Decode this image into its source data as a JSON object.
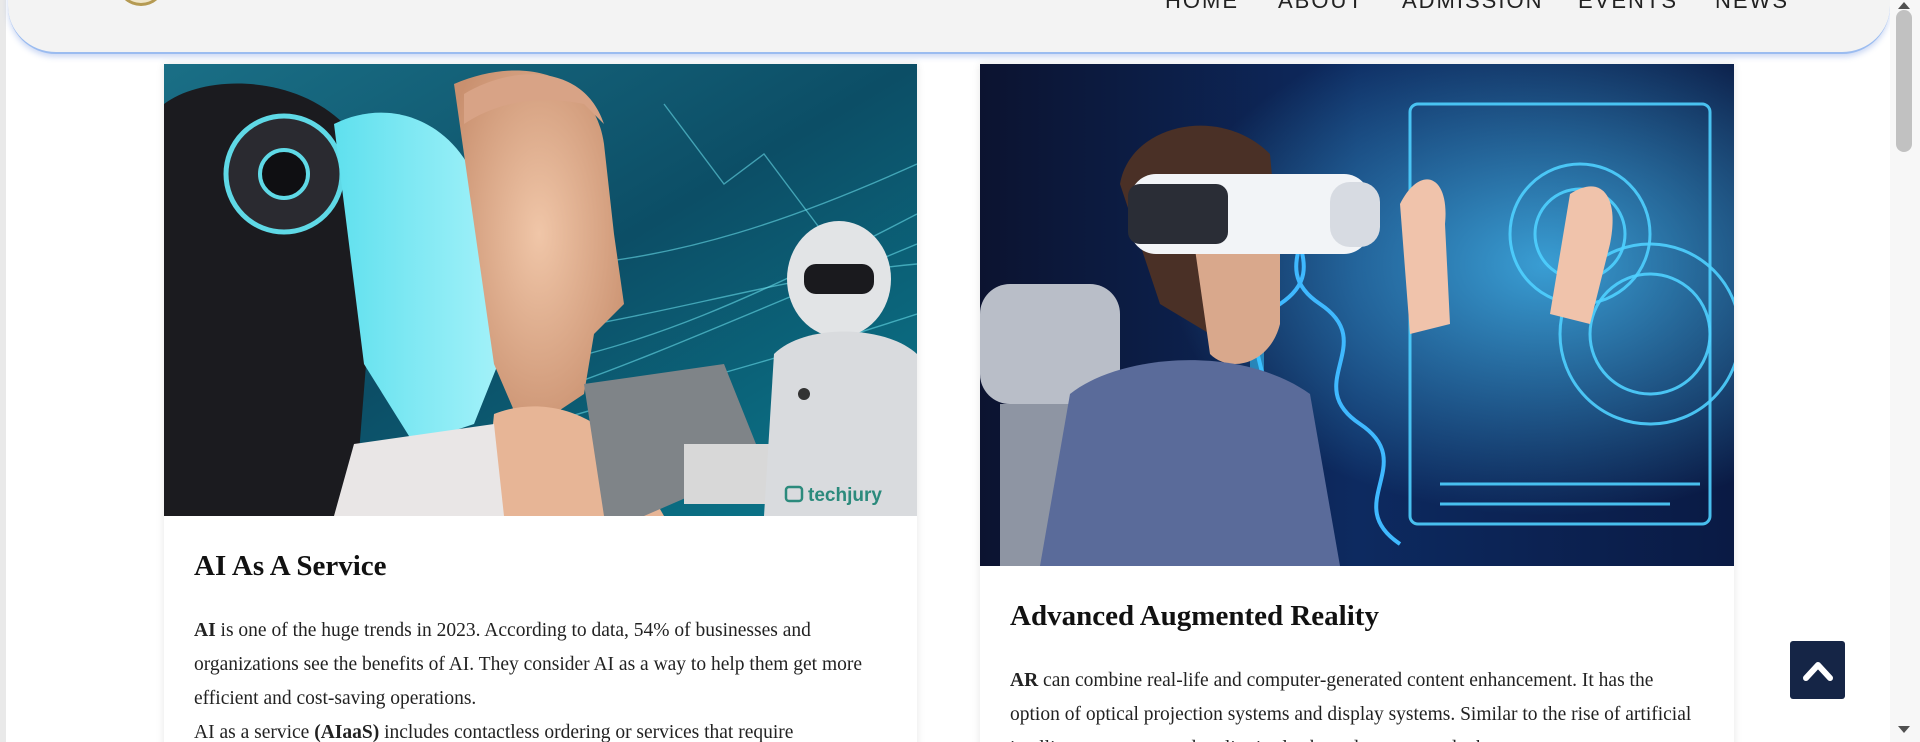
{
  "nav": {
    "items": [
      {
        "label": "HOME"
      },
      {
        "label": "ABOUT"
      },
      {
        "label": "ADMISSION"
      },
      {
        "label": "EVENTS"
      },
      {
        "label": "NEWS"
      }
    ]
  },
  "cards": [
    {
      "image_watermark": "techjury",
      "title": "AI As A Service",
      "p1_bold": "AI",
      "p1_text": " is one of the huge trends in 2023. According to data, 54% of businesses and organizations see the benefits of AI. They consider AI as a way to help them get more efficient and cost-saving operations.",
      "p2_pre": "AI as a service ",
      "p2_bold": "(AIaaS)",
      "p2_post": " includes contactless ordering or services that require"
    },
    {
      "title": "Advanced Augmented Reality",
      "p1_bold": "AR",
      "p1_text": " can combine real-life and computer-generated content enhancement. It has the option of optical projection systems and display systems. Similar to the rise of artificial intelligence, augmented reality is also bound to grow and take"
    }
  ],
  "colors": {
    "nav_border": "#9bbcf0",
    "to_top_bg": "#152546",
    "title": "#111111"
  },
  "icons": {
    "to_top": "chevron-up-icon",
    "logo": "school-crest-logo"
  }
}
